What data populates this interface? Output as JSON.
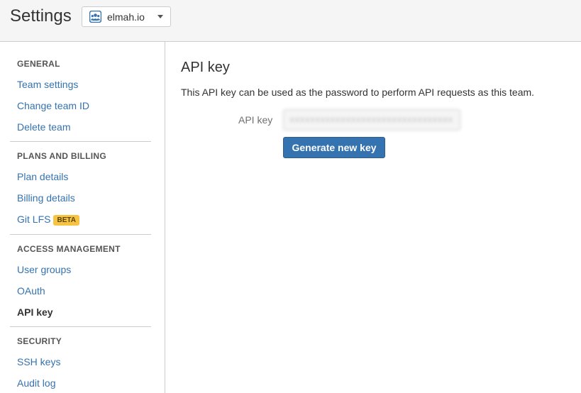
{
  "header": {
    "title": "Settings",
    "team": {
      "name": "elmah.io",
      "avatar_icon": "team-avatar-icon"
    }
  },
  "sidebar": {
    "sections": [
      {
        "heading": "GENERAL",
        "items": [
          {
            "label": "Team settings"
          },
          {
            "label": "Change team ID"
          },
          {
            "label": "Delete team"
          }
        ]
      },
      {
        "heading": "PLANS AND BILLING",
        "items": [
          {
            "label": "Plan details"
          },
          {
            "label": "Billing details"
          },
          {
            "label": "Git LFS",
            "badge": "BETA"
          }
        ]
      },
      {
        "heading": "ACCESS MANAGEMENT",
        "items": [
          {
            "label": "User groups"
          },
          {
            "label": "OAuth"
          },
          {
            "label": "API key",
            "active": true
          }
        ]
      },
      {
        "heading": "SECURITY",
        "items": [
          {
            "label": "SSH keys"
          },
          {
            "label": "Audit log"
          }
        ]
      }
    ]
  },
  "main": {
    "title": "API key",
    "description": "This API key can be used as the password to perform API requests as this team.",
    "field_label": "API key",
    "api_key_value": "xxxxxxxxxxxxxxxxxxxxxxxxxxxxxxxx",
    "generate_button": "Generate new key"
  },
  "colors": {
    "link": "#3572b0",
    "primary_button": "#3572b0",
    "badge_bg": "#f6c342",
    "header_bg": "#f5f5f5"
  }
}
